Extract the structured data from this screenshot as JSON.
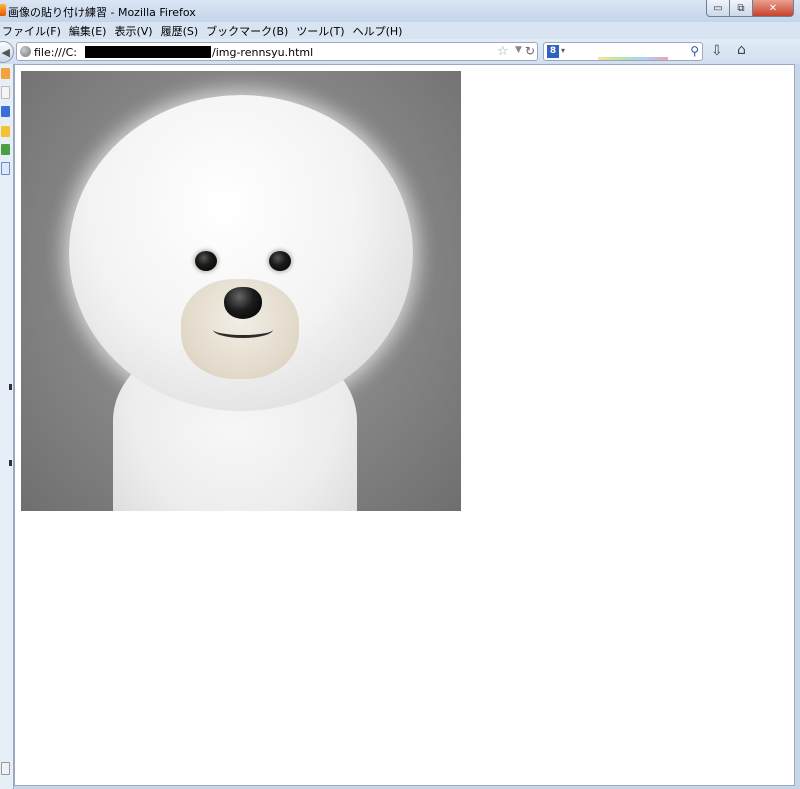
{
  "window": {
    "title": "画像の貼り付け練習 - Mozilla Firefox",
    "minimize_label": "▭",
    "restore_label": "⧉",
    "close_label": "✕"
  },
  "menu": {
    "items": [
      "ファイル(F)",
      "編集(E)",
      "表示(V)",
      "履歴(S)",
      "ブックマーク(B)",
      "ツール(T)",
      "ヘルプ(H)"
    ]
  },
  "navigation": {
    "url_prefix": "file:///C:",
    "url_suffix": "/img-rennsyu.html",
    "search_engine_label": "8",
    "search_placeholder": ""
  },
  "content": {
    "image_alt": "白いビションフリーゼの写真"
  },
  "colors": {
    "chrome": "#c7d6e9",
    "close_button": "#c7412b"
  }
}
